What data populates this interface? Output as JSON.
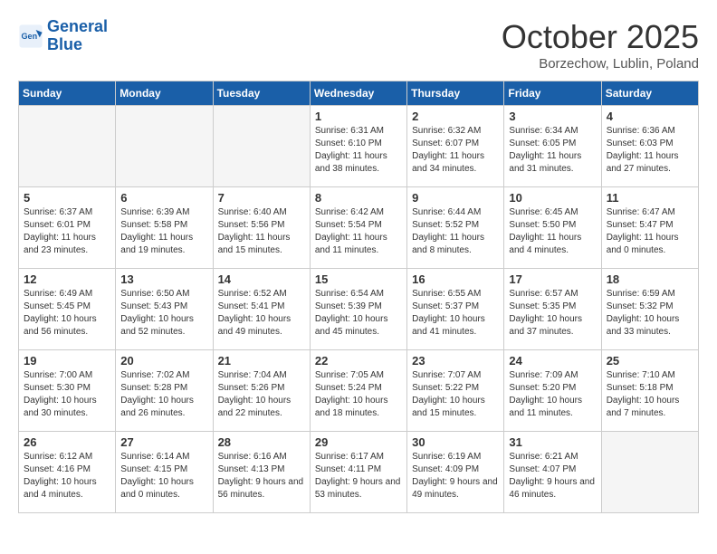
{
  "logo": {
    "line1": "General",
    "line2": "Blue"
  },
  "title": "October 2025",
  "subtitle": "Borzechow, Lublin, Poland",
  "days_of_week": [
    "Sunday",
    "Monday",
    "Tuesday",
    "Wednesday",
    "Thursday",
    "Friday",
    "Saturday"
  ],
  "weeks": [
    [
      {
        "day": null
      },
      {
        "day": null
      },
      {
        "day": null
      },
      {
        "day": "1",
        "sunrise": "6:31 AM",
        "sunset": "6:10 PM",
        "daylight": "11 hours and 38 minutes."
      },
      {
        "day": "2",
        "sunrise": "6:32 AM",
        "sunset": "6:07 PM",
        "daylight": "11 hours and 34 minutes."
      },
      {
        "day": "3",
        "sunrise": "6:34 AM",
        "sunset": "6:05 PM",
        "daylight": "11 hours and 31 minutes."
      },
      {
        "day": "4",
        "sunrise": "6:36 AM",
        "sunset": "6:03 PM",
        "daylight": "11 hours and 27 minutes."
      }
    ],
    [
      {
        "day": "5",
        "sunrise": "6:37 AM",
        "sunset": "6:01 PM",
        "daylight": "11 hours and 23 minutes."
      },
      {
        "day": "6",
        "sunrise": "6:39 AM",
        "sunset": "5:58 PM",
        "daylight": "11 hours and 19 minutes."
      },
      {
        "day": "7",
        "sunrise": "6:40 AM",
        "sunset": "5:56 PM",
        "daylight": "11 hours and 15 minutes."
      },
      {
        "day": "8",
        "sunrise": "6:42 AM",
        "sunset": "5:54 PM",
        "daylight": "11 hours and 11 minutes."
      },
      {
        "day": "9",
        "sunrise": "6:44 AM",
        "sunset": "5:52 PM",
        "daylight": "11 hours and 8 minutes."
      },
      {
        "day": "10",
        "sunrise": "6:45 AM",
        "sunset": "5:50 PM",
        "daylight": "11 hours and 4 minutes."
      },
      {
        "day": "11",
        "sunrise": "6:47 AM",
        "sunset": "5:47 PM",
        "daylight": "11 hours and 0 minutes."
      }
    ],
    [
      {
        "day": "12",
        "sunrise": "6:49 AM",
        "sunset": "5:45 PM",
        "daylight": "10 hours and 56 minutes."
      },
      {
        "day": "13",
        "sunrise": "6:50 AM",
        "sunset": "5:43 PM",
        "daylight": "10 hours and 52 minutes."
      },
      {
        "day": "14",
        "sunrise": "6:52 AM",
        "sunset": "5:41 PM",
        "daylight": "10 hours and 49 minutes."
      },
      {
        "day": "15",
        "sunrise": "6:54 AM",
        "sunset": "5:39 PM",
        "daylight": "10 hours and 45 minutes."
      },
      {
        "day": "16",
        "sunrise": "6:55 AM",
        "sunset": "5:37 PM",
        "daylight": "10 hours and 41 minutes."
      },
      {
        "day": "17",
        "sunrise": "6:57 AM",
        "sunset": "5:35 PM",
        "daylight": "10 hours and 37 minutes."
      },
      {
        "day": "18",
        "sunrise": "6:59 AM",
        "sunset": "5:32 PM",
        "daylight": "10 hours and 33 minutes."
      }
    ],
    [
      {
        "day": "19",
        "sunrise": "7:00 AM",
        "sunset": "5:30 PM",
        "daylight": "10 hours and 30 minutes."
      },
      {
        "day": "20",
        "sunrise": "7:02 AM",
        "sunset": "5:28 PM",
        "daylight": "10 hours and 26 minutes."
      },
      {
        "day": "21",
        "sunrise": "7:04 AM",
        "sunset": "5:26 PM",
        "daylight": "10 hours and 22 minutes."
      },
      {
        "day": "22",
        "sunrise": "7:05 AM",
        "sunset": "5:24 PM",
        "daylight": "10 hours and 18 minutes."
      },
      {
        "day": "23",
        "sunrise": "7:07 AM",
        "sunset": "5:22 PM",
        "daylight": "10 hours and 15 minutes."
      },
      {
        "day": "24",
        "sunrise": "7:09 AM",
        "sunset": "5:20 PM",
        "daylight": "10 hours and 11 minutes."
      },
      {
        "day": "25",
        "sunrise": "7:10 AM",
        "sunset": "5:18 PM",
        "daylight": "10 hours and 7 minutes."
      }
    ],
    [
      {
        "day": "26",
        "sunrise": "6:12 AM",
        "sunset": "4:16 PM",
        "daylight": "10 hours and 4 minutes."
      },
      {
        "day": "27",
        "sunrise": "6:14 AM",
        "sunset": "4:15 PM",
        "daylight": "10 hours and 0 minutes."
      },
      {
        "day": "28",
        "sunrise": "6:16 AM",
        "sunset": "4:13 PM",
        "daylight": "9 hours and 56 minutes."
      },
      {
        "day": "29",
        "sunrise": "6:17 AM",
        "sunset": "4:11 PM",
        "daylight": "9 hours and 53 minutes."
      },
      {
        "day": "30",
        "sunrise": "6:19 AM",
        "sunset": "4:09 PM",
        "daylight": "9 hours and 49 minutes."
      },
      {
        "day": "31",
        "sunrise": "6:21 AM",
        "sunset": "4:07 PM",
        "daylight": "9 hours and 46 minutes."
      },
      {
        "day": null
      }
    ]
  ]
}
